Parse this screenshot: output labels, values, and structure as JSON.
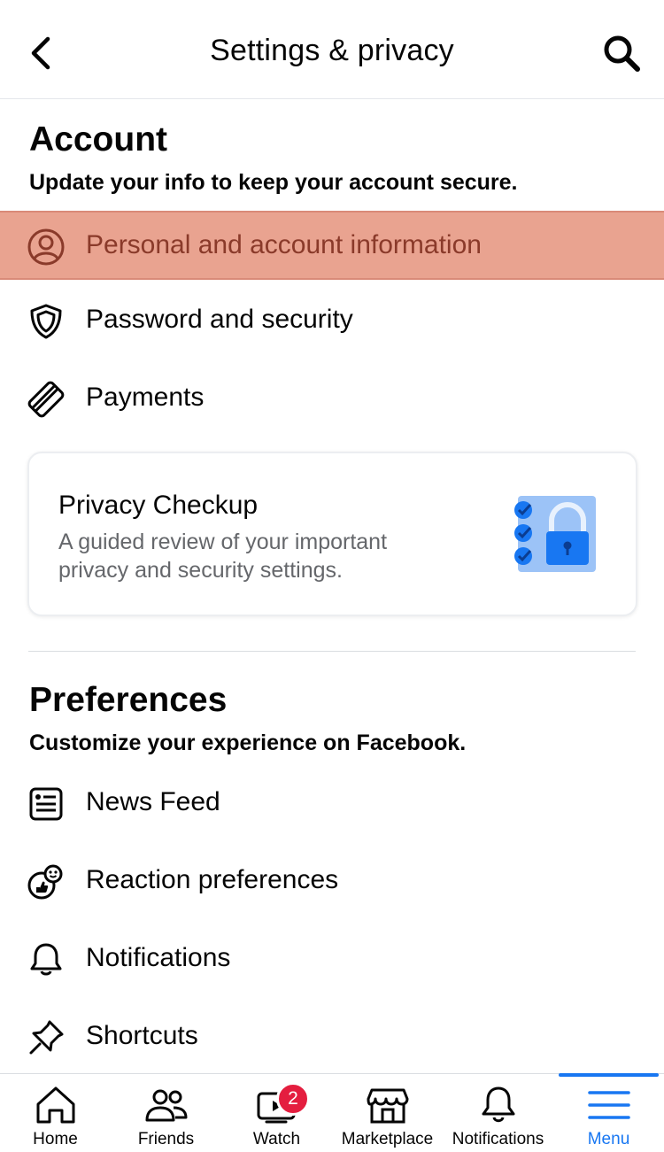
{
  "header": {
    "title": "Settings & privacy"
  },
  "account": {
    "title": "Account",
    "subtitle": "Update your info to keep your account secure.",
    "items": [
      {
        "label": "Personal and account information",
        "icon": "user-circle-icon"
      },
      {
        "label": "Password and security",
        "icon": "shield-icon"
      },
      {
        "label": "Payments",
        "icon": "credit-card-icon"
      }
    ]
  },
  "privacy_checkup": {
    "title": "Privacy Checkup",
    "description": "A guided review of your important privacy and security settings.",
    "icon": "lock-checklist-icon"
  },
  "preferences": {
    "title": "Preferences",
    "subtitle": "Customize your experience on Facebook.",
    "items": [
      {
        "label": "News Feed",
        "icon": "news-feed-icon"
      },
      {
        "label": "Reaction preferences",
        "icon": "reaction-icon"
      },
      {
        "label": "Notifications",
        "icon": "bell-icon"
      },
      {
        "label": "Shortcuts",
        "icon": "pin-icon"
      }
    ]
  },
  "tabbar": {
    "tabs": [
      {
        "label": "Home",
        "icon": "home-icon"
      },
      {
        "label": "Friends",
        "icon": "friends-icon"
      },
      {
        "label": "Watch",
        "icon": "watch-icon",
        "badge": "2"
      },
      {
        "label": "Marketplace",
        "icon": "marketplace-icon"
      },
      {
        "label": "Notifications",
        "icon": "bell-icon"
      },
      {
        "label": "Menu",
        "icon": "menu-icon",
        "active": true
      }
    ]
  },
  "colors": {
    "accent": "#1877f2",
    "highlight": "#e9a390",
    "badge": "#e41e3f"
  }
}
